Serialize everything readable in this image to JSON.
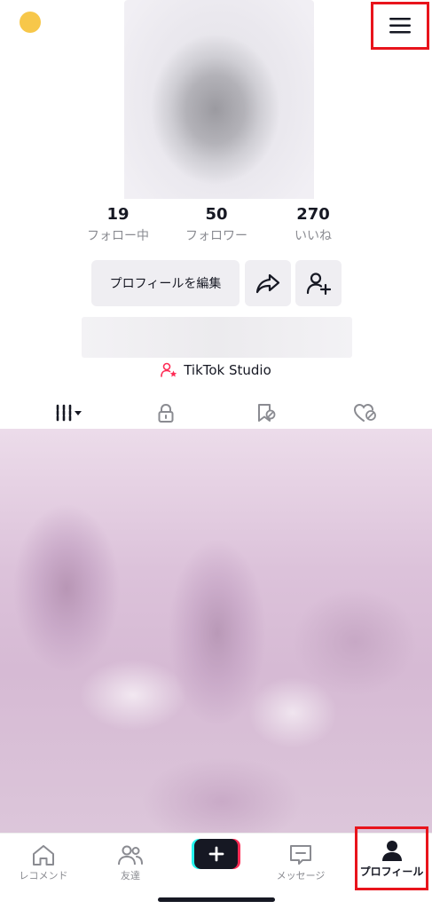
{
  "profile": {
    "stats": [
      {
        "value": "19",
        "label": "フォロー中"
      },
      {
        "value": "50",
        "label": "フォロワー"
      },
      {
        "value": "270",
        "label": "いいね"
      }
    ],
    "edit_button": "プロフィールを編集",
    "studio_link": "TikTok Studio"
  },
  "tabs": [
    {
      "icon": "grid-icon"
    },
    {
      "icon": "lock-icon"
    },
    {
      "icon": "bookmark-icon"
    },
    {
      "icon": "liked-icon"
    }
  ],
  "nav": {
    "items": [
      {
        "label": "レコメンド",
        "icon": "home-icon"
      },
      {
        "label": "友達",
        "icon": "friends-icon"
      },
      {
        "label": "",
        "icon": "plus-icon"
      },
      {
        "label": "メッセージ",
        "icon": "message-icon"
      },
      {
        "label": "プロフィール",
        "icon": "profile-icon"
      }
    ]
  },
  "colors": {
    "accent_red": "#e8141c",
    "brand_pink": "#fe2c55",
    "brand_cyan": "#25f4ee"
  }
}
